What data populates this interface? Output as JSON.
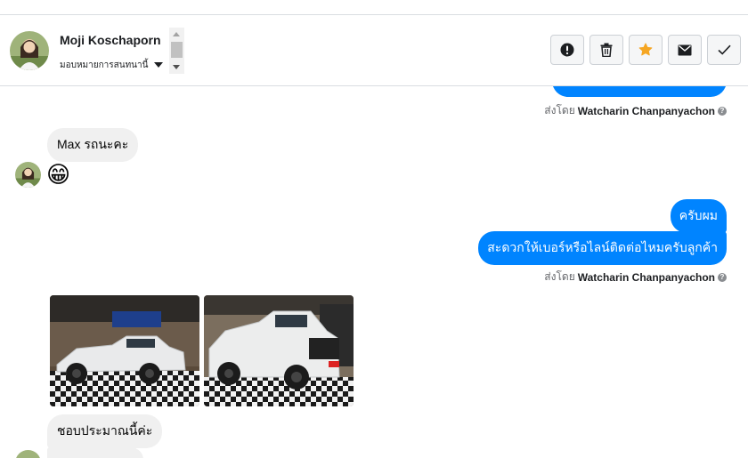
{
  "header": {
    "contact_name": "Moji Koschaporn",
    "assign_label": "มอบหมายการสนทนานี้"
  },
  "actions": [
    {
      "name": "spam-button",
      "icon": "exclamation-circle-icon"
    },
    {
      "name": "delete-button",
      "icon": "trash-icon"
    },
    {
      "name": "star-button",
      "icon": "star-icon",
      "color": "#f5a623"
    },
    {
      "name": "mark-unread-button",
      "icon": "envelope-icon"
    },
    {
      "name": "mark-done-button",
      "icon": "checkmark-icon"
    }
  ],
  "colors": {
    "outgoing_bubble": "#0084ff",
    "incoming_bubble": "#f0f0f0",
    "accent_star": "#f5a623"
  },
  "messages": {
    "sent_by_prefix": "ส่งโดย",
    "agent_name": "Watcharin Chanpanyachon",
    "in_1": "Max รถนะคะ",
    "in_emoji": "😁",
    "out_1": "ครับผม",
    "out_2": "สะดวกให้เบอร์หรือไลน์ติดต่อไหมครับลูกค้า",
    "in_2": "ชอบประมาณนี้ค่ะ"
  }
}
